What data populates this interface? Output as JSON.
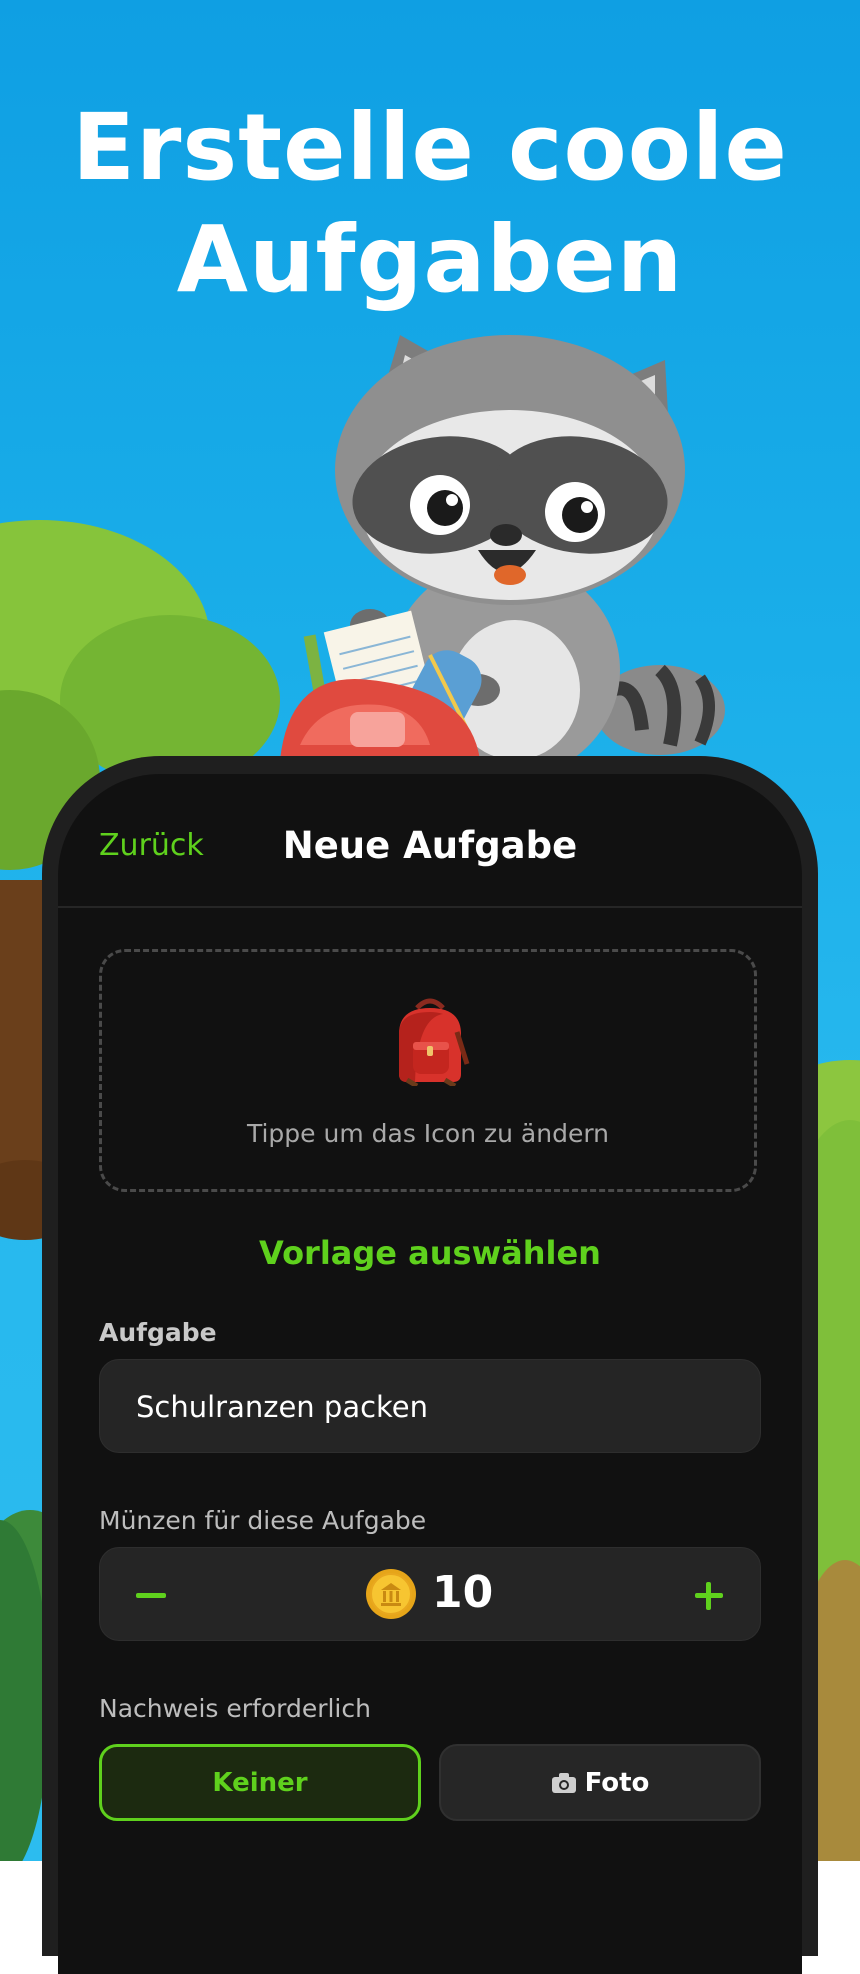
{
  "headline": {
    "line1": "Erstelle coole",
    "line2": "Aufgaben"
  },
  "nav": {
    "back_label": "Zurück",
    "title": "Neue Aufgabe"
  },
  "icon_picker": {
    "icon": "backpack-icon",
    "hint": "Tippe um das Icon zu ändern"
  },
  "template_link": "Vorlage auswählen",
  "task": {
    "label": "Aufgabe",
    "value": "Schulranzen packen"
  },
  "coins": {
    "label": "Münzen für diese Aufgabe",
    "value": "10",
    "icon": "coin-icon"
  },
  "proof": {
    "label": "Nachweis erforderlich",
    "options": [
      {
        "label": "Keiner",
        "selected": true
      },
      {
        "label": "Foto",
        "icon": "camera-icon",
        "selected": false
      }
    ]
  },
  "colors": {
    "accent": "#5fd11d",
    "sky": "#1aaee9",
    "screen_bg": "#111111",
    "field_bg": "#252525"
  }
}
